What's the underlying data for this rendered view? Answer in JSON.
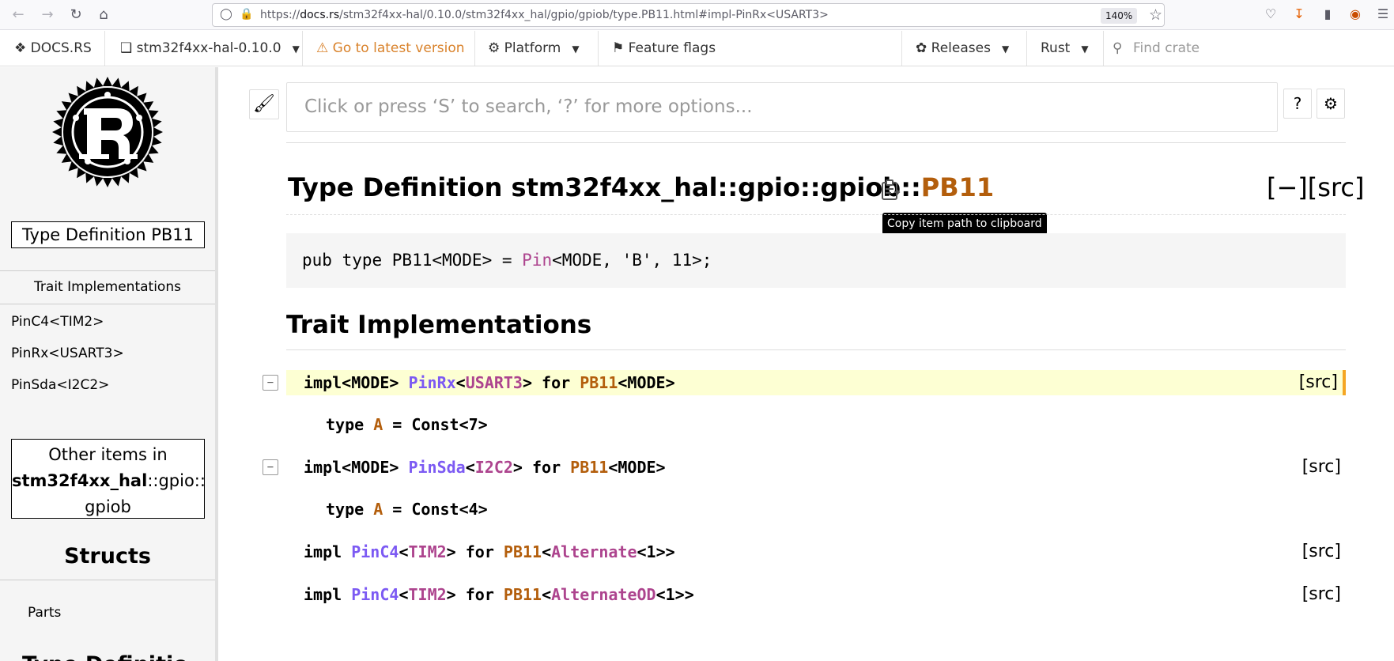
{
  "browser": {
    "url_prefix": "https://",
    "url_host": "docs.rs",
    "url_path": "/stm32f4xx-hal/0.10.0/stm32f4xx_hal/gpio/gpiob/type.PB11.html#impl-PinRx<USART3>",
    "zoom": "140%"
  },
  "docsnav": {
    "brand": "DOCS.RS",
    "crate": "stm32f4xx-hal-0.10.0",
    "latest": "Go to latest version",
    "platform": "Platform",
    "feature_flags": "Feature flags",
    "releases": "Releases",
    "rust": "Rust",
    "find_placeholder": "Find crate"
  },
  "sidebar": {
    "title": "Type Definition PB11",
    "trait_impl_heading": "Trait Implementations",
    "trait_links": [
      "PinC4<TIM2>",
      "PinRx<USART3>",
      "PinSda<I2C2>"
    ],
    "other_items_line1": "Other items in",
    "other_items_crate": "stm32f4xx_hal",
    "other_items_path": "::gpio::",
    "other_items_last": "gpiob",
    "structs_heading": "Structs",
    "structs": [
      "Parts"
    ],
    "cut_heading": "Type Definitio"
  },
  "main": {
    "search_placeholder": "Click or press ‘S’ to search, ‘?’ for more options...",
    "help_label": "?",
    "title_prefix": "Type Definition stm32f4xx_hal::gpio::gpiob::",
    "title_name": "PB11",
    "tooltip": "Copy item path to clipboard",
    "out_of_band": "[−][src]",
    "code_pre": "pub type PB11<MODE> = ",
    "code_pin": "Pin",
    "code_post": "<MODE, 'B', 11>;",
    "section_title": "Trait Implementations",
    "src_label": "[src]",
    "toggle_label": "−",
    "impls": [
      {
        "pre": "impl<MODE> ",
        "trait": "PinRx",
        "lt": "<",
        "arg": "USART3",
        "gt": "> for ",
        "ty": "PB11",
        "post": "<MODE>",
        "assoc_pre": "type ",
        "assoc_name": "A",
        "assoc_post": " = Const<7>"
      },
      {
        "pre": "impl<MODE> ",
        "trait": "PinSda",
        "lt": "<",
        "arg": "I2C2",
        "gt": "> for ",
        "ty": "PB11",
        "post": "<MODE>",
        "assoc_pre": "type ",
        "assoc_name": "A",
        "assoc_post": " = Const<4>"
      },
      {
        "pre": "impl ",
        "trait": "PinC4",
        "lt": "<",
        "arg": "TIM2",
        "gt": "> for ",
        "ty": "PB11",
        "lt2": "<",
        "wrap": "Alternate",
        "post": "<1>>"
      },
      {
        "pre": "impl ",
        "trait": "PinC4",
        "lt": "<",
        "arg": "TIM2",
        "gt": "> for ",
        "ty": "PB11",
        "lt2": "<",
        "wrap": "AlternateOD",
        "post": "<1>>"
      }
    ]
  }
}
